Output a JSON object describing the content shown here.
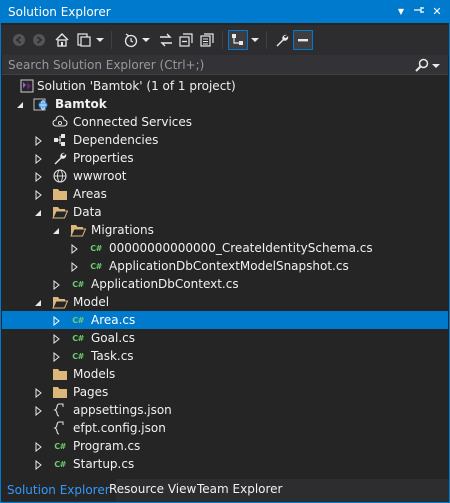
{
  "window": {
    "title": "Solution Explorer",
    "accent": "#007acc",
    "dropdown_glyph": "▼",
    "pin_glyph": "⊣",
    "close_glyph": "✕"
  },
  "toolbar": {
    "icons": [
      "back-icon",
      "forward-icon",
      "home-icon",
      "switch-views-icon",
      "pending-changes-filter-icon",
      "sync-icon",
      "collapse-all-icon",
      "show-all-files-icon",
      "sync-with-active-document-icon",
      "properties-wrench-icon",
      "preview-selected-items-icon"
    ]
  },
  "search": {
    "placeholder": "Search Solution Explorer (Ctrl+;)"
  },
  "tree": {
    "solution": "Solution 'Bamtok' (1 of 1 project)",
    "project": "Bamtok",
    "connected_services": "Connected Services",
    "dependencies": "Dependencies",
    "properties": "Properties",
    "wwwroot": "wwwroot",
    "areas": "Areas",
    "data": "Data",
    "migrations": "Migrations",
    "migration_file": "00000000000000_CreateIdentitySchema.cs",
    "snapshot_file": "ApplicationDbContextModelSnapshot.cs",
    "dbcontext_file": "ApplicationDbContext.cs",
    "model": "Model",
    "area_file": "Area.cs",
    "goal_file": "Goal.cs",
    "task_file": "Task.cs",
    "models": "Models",
    "pages": "Pages",
    "appsettings": "appsettings.json",
    "efpt": "efpt.config.json",
    "program": "Program.cs",
    "startup": "Startup.cs",
    "cs_badge": "C#"
  },
  "tabs": {
    "solution_explorer": "Solution Explorer",
    "resource_view": "Resource View",
    "team_explorer": "Team Explorer"
  },
  "colors": {
    "background": "#252526",
    "selection": "#007acc",
    "folder": "#dcb67a",
    "csharp": "#6cce6c",
    "active_tab_text": "#3399ff"
  }
}
